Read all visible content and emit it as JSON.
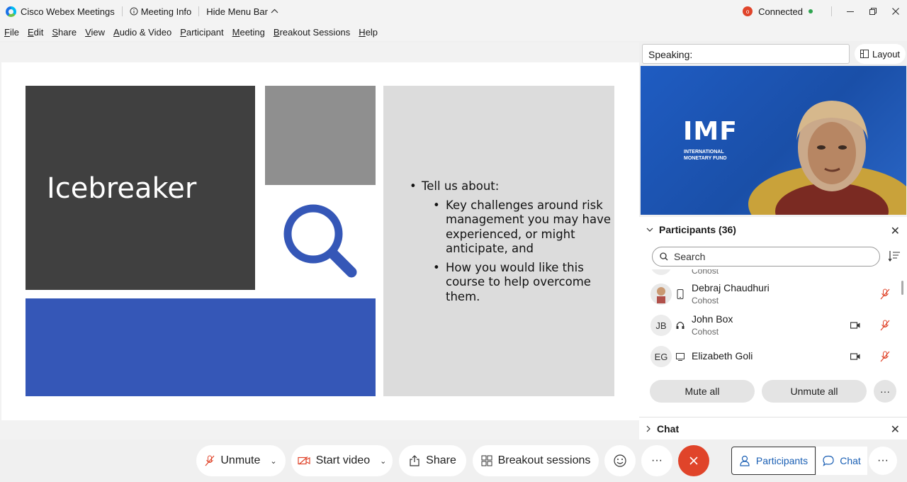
{
  "titlebar": {
    "app_name": "Cisco Webex Meetings",
    "meeting_info": "Meeting Info",
    "hide_menu": "Hide Menu Bar",
    "connection": "Connected",
    "connection_letter": "o"
  },
  "menu": [
    "File",
    "Edit",
    "Share",
    "View",
    "Audio & Video",
    "Participant",
    "Meeting",
    "Breakout Sessions",
    "Help"
  ],
  "slide": {
    "title": "Icebreaker",
    "bullet_main": "Tell us about:",
    "bullet_sub1": "Key challenges around risk management you may have experienced, or might anticipate, and",
    "bullet_sub2": "How you would like this course to help overcome them."
  },
  "side": {
    "speaking_label": "Speaking:",
    "layout_label": "Layout",
    "video_logo": "IMF",
    "video_logo_sub1": "INTERNATIONAL",
    "video_logo_sub2": "MONETARY FUND"
  },
  "participants": {
    "header": "Participants (36)",
    "search_placeholder": "Search",
    "partial_role": "Cohost",
    "rows": [
      {
        "name": "Debraj Chaudhuri",
        "role": "Cohost",
        "initials": ""
      },
      {
        "name": "John Box",
        "role": "Cohost",
        "initials": "JB"
      },
      {
        "name": "Elizabeth Goli",
        "role": "",
        "initials": "EG"
      }
    ],
    "mute_all": "Mute all",
    "unmute_all": "Unmute all",
    "more": "···"
  },
  "chat": {
    "header": "Chat"
  },
  "controls": {
    "unmute": "Unmute",
    "start_video": "Start video",
    "share": "Share",
    "breakout": "Breakout sessions",
    "more": "···",
    "participants": "Participants",
    "chat": "Chat"
  },
  "colors": {
    "accent_blue": "#3557b7",
    "end_red": "#e0442a",
    "mute_red": "#e0442a"
  }
}
